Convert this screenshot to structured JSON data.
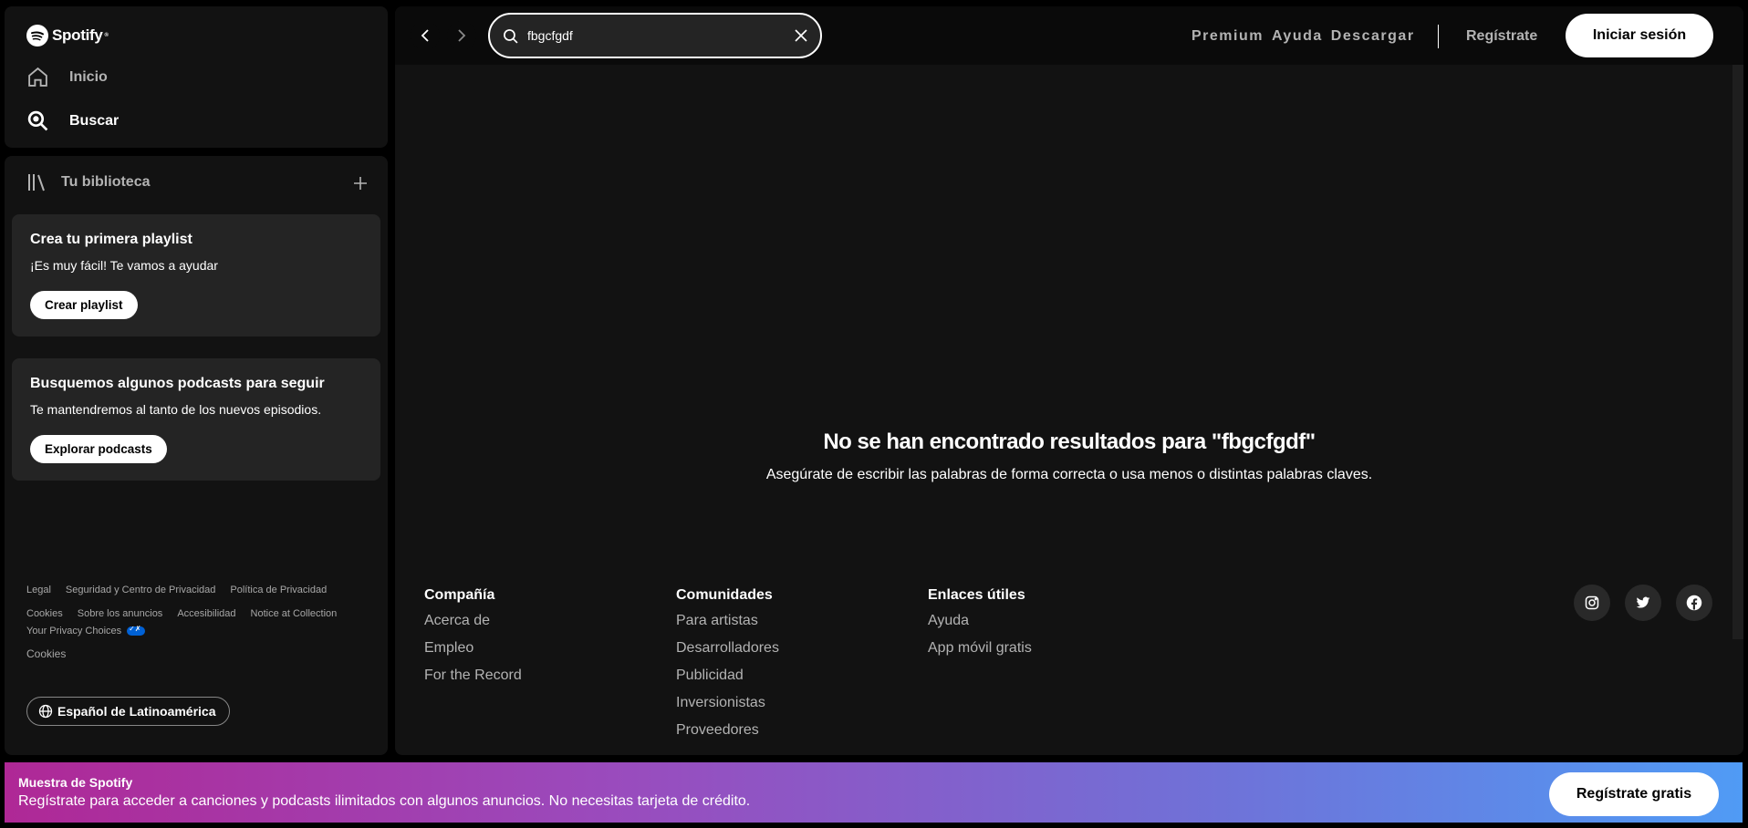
{
  "app": {
    "name": "Spotify"
  },
  "nav": {
    "home": "Inicio",
    "search": "Buscar"
  },
  "library": {
    "title": "Tu biblioteca",
    "cards": [
      {
        "title": "Crea tu primera playlist",
        "text": "¡Es muy fácil! Te vamos a ayudar",
        "button": "Crear playlist"
      },
      {
        "title": "Busquemos algunos podcasts para seguir",
        "text": "Te mantendremos al tanto de los nuevos episodios.",
        "button": "Explorar podcasts"
      }
    ]
  },
  "legal": {
    "row1": [
      "Legal",
      "Seguridad y Centro de Privacidad",
      "Política de Privacidad"
    ],
    "row2": [
      "Cookies",
      "Sobre los anuncios",
      "Accesibilidad",
      "Notice at Collection"
    ],
    "privacy_choices": "Your Privacy Choices",
    "cookies": "Cookies"
  },
  "language": "Español de Latinoamérica",
  "topbar": {
    "search_value": "fbgcfgdf",
    "links": [
      "Premium",
      "Ayuda",
      "Descargar"
    ],
    "signup": "Regístrate",
    "login": "Iniciar sesión"
  },
  "results": {
    "title": "No se han encontrado resultados para \"fbgcfgdf\"",
    "subtitle": "Asegúrate de escribir las palabras de forma correcta o usa menos o distintas palabras claves."
  },
  "footer": {
    "columns": [
      {
        "title": "Compañía",
        "links": [
          "Acerca de",
          "Empleo",
          "For the Record"
        ]
      },
      {
        "title": "Comunidades",
        "links": [
          "Para artistas",
          "Desarrolladores",
          "Publicidad",
          "Inversionistas",
          "Proveedores"
        ]
      },
      {
        "title": "Enlaces útiles",
        "links": [
          "Ayuda",
          "App móvil gratis"
        ]
      }
    ],
    "social_icons": [
      "instagram-icon",
      "twitter-icon",
      "facebook-icon"
    ]
  },
  "banner": {
    "title": "Muestra de Spotify",
    "text": "Regístrate para acceder a canciones y podcasts ilimitados con algunos anuncios. No necesitas tarjeta de crédito.",
    "button": "Regístrate gratis"
  },
  "colors": {
    "brand_green": "#1ed760",
    "background": "#121212",
    "banner_start": "#af2896",
    "banner_end": "#509bf5"
  }
}
